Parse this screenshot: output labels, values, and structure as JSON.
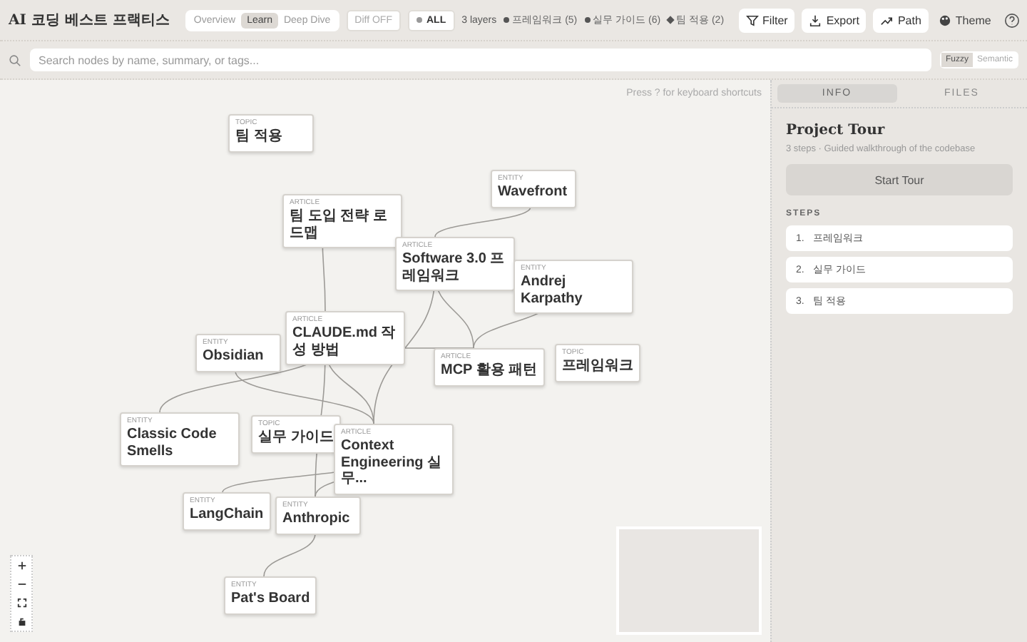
{
  "app_title": "AI 코딩 베스트 프랙티스",
  "modes": [
    {
      "label": "Overview",
      "selected": false
    },
    {
      "label": "Learn",
      "selected": true
    },
    {
      "label": "Deep Dive",
      "selected": false
    }
  ],
  "diff": {
    "label": "Diff OFF",
    "on": false
  },
  "all_filter": {
    "label": "ALL",
    "selected": true
  },
  "layers_count": "3 layers",
  "layers": [
    {
      "label": "프레임워크 (5)",
      "kind": "dot"
    },
    {
      "label": "실무 가이드 (6)",
      "kind": "dot"
    },
    {
      "label": "팀 적용 (2)",
      "kind": "diamond"
    }
  ],
  "toolbar": [
    {
      "label": "Filter",
      "kind": "filter"
    },
    {
      "label": "Export",
      "kind": "export"
    },
    {
      "label": "Path",
      "kind": "path"
    }
  ],
  "theme": {
    "label": "Theme"
  },
  "search": {
    "placeholder": "Search nodes by name, summary, or tags..."
  },
  "search_modes": [
    {
      "label": "Fuzzy",
      "selected": true
    },
    {
      "label": "Semantic",
      "selected": false
    }
  ],
  "hint": "Press ? for keyboard shortcuts",
  "nodes": [
    {
      "type": "TOPIC",
      "title": "팀 적용"
    },
    {
      "type": "ARTICLE",
      "title": "팀 도입 전략 로드맵"
    },
    {
      "type": "ENTITY",
      "title": "Wavefront"
    },
    {
      "type": "ARTICLE",
      "title": "Software 3.0 프레임워크"
    },
    {
      "type": "ENTITY",
      "title": "Andrej Karpathy"
    },
    {
      "type": "ENTITY",
      "title": "Obsidian"
    },
    {
      "type": "ARTICLE",
      "title": "CLAUDE.md 작성 방법"
    },
    {
      "type": "ARTICLE",
      "title": "MCP 활용 패턴"
    },
    {
      "type": "TOPIC",
      "title": "프레임워크"
    },
    {
      "type": "ENTITY",
      "title": "Classic Code Smells"
    },
    {
      "type": "TOPIC",
      "title": "실무 가이드"
    },
    {
      "type": "ARTICLE",
      "title": "Context Engineering 실무..."
    },
    {
      "type": "ENTITY",
      "title": "LangChain"
    },
    {
      "type": "ENTITY",
      "title": "Anthropic"
    },
    {
      "type": "ENTITY",
      "title": "Pat's Board"
    }
  ],
  "panel_tabs": [
    {
      "label": "INFO",
      "selected": true
    },
    {
      "label": "FILES",
      "selected": false
    }
  ],
  "tour": {
    "title": "Project Tour",
    "subtitle": "3 steps · Guided walkthrough of the codebase",
    "start": "Start Tour",
    "steps_heading": "STEPS",
    "steps": [
      {
        "number": "1.",
        "label": "프레임워크"
      },
      {
        "number": "2.",
        "label": "실무 가이드"
      },
      {
        "number": "3.",
        "label": "팀 적용"
      }
    ]
  }
}
